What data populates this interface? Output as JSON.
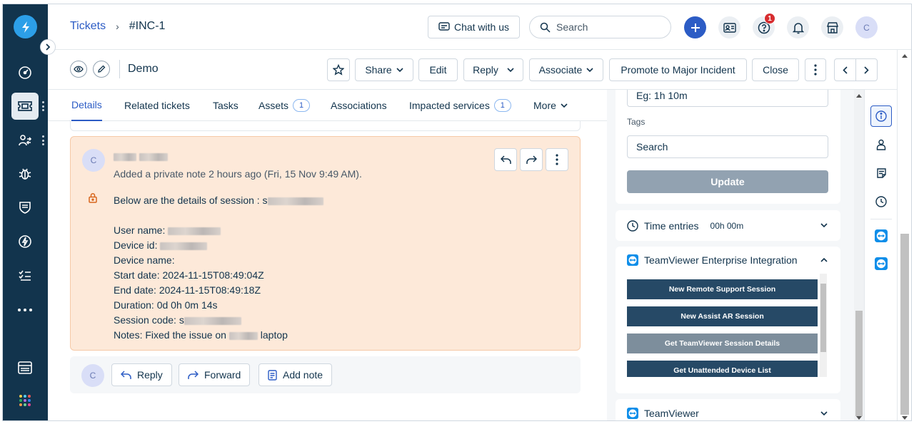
{
  "header": {
    "breadcrumb_link": "Tickets",
    "breadcrumb_sep": "›",
    "ticket_id": "#INC-1",
    "chat_label": "Chat with us",
    "search_placeholder": "Search",
    "notification_count": "1",
    "user_initial": "C"
  },
  "toolbar": {
    "title": "Demo",
    "share": "Share",
    "edit": "Edit",
    "reply": "Reply",
    "associate": "Associate",
    "promote": "Promote to Major Incident",
    "close": "Close"
  },
  "tabs": [
    {
      "label": "Details",
      "active": true
    },
    {
      "label": "Related tickets"
    },
    {
      "label": "Tasks"
    },
    {
      "label": "Assets",
      "count": "1"
    },
    {
      "label": "Associations"
    },
    {
      "label": "Impacted services",
      "count": "1"
    },
    {
      "label": "More"
    }
  ],
  "note": {
    "avatar": "C",
    "meta": "Added a private note 2 hours ago (Fri, 15 Nov 9:49 AM).",
    "intro": "Below are the details of session : s",
    "user_name_label": "User name:",
    "device_id_label": "Device id:",
    "device_name_label": "Device name:",
    "start_date": "Start date: 2024-11-15T08:49:04Z",
    "end_date": "End date: 2024-11-15T08:49:18Z",
    "duration": "Duration: 0d 0h 0m 14s",
    "session_code_label": "Session code: s",
    "notes_prefix": "Notes: Fixed the issue on",
    "notes_suffix": "laptop"
  },
  "reply_bar": {
    "avatar": "C",
    "reply": "Reply",
    "forward": "Forward",
    "add_note": "Add note"
  },
  "right_panel": {
    "time_placeholder": "Eg: 1h 10m",
    "tags_label": "Tags",
    "tags_placeholder": "Search",
    "update": "Update",
    "time_entries_label": "Time entries",
    "time_entries_value": "00h 00m",
    "integration_title": "TeamViewer Enterprise Integration",
    "integration_buttons": [
      "New Remote Support Session",
      "New Assist AR Session",
      "Get TeamViewer Session Details",
      "Get Unattended Device List"
    ],
    "teamviewer_title": "TeamViewer"
  },
  "colors": {
    "nav_bg": "#12344d",
    "accent": "#2c5cc5",
    "note_bg": "#fde9d9",
    "tv_button": "#264966"
  }
}
